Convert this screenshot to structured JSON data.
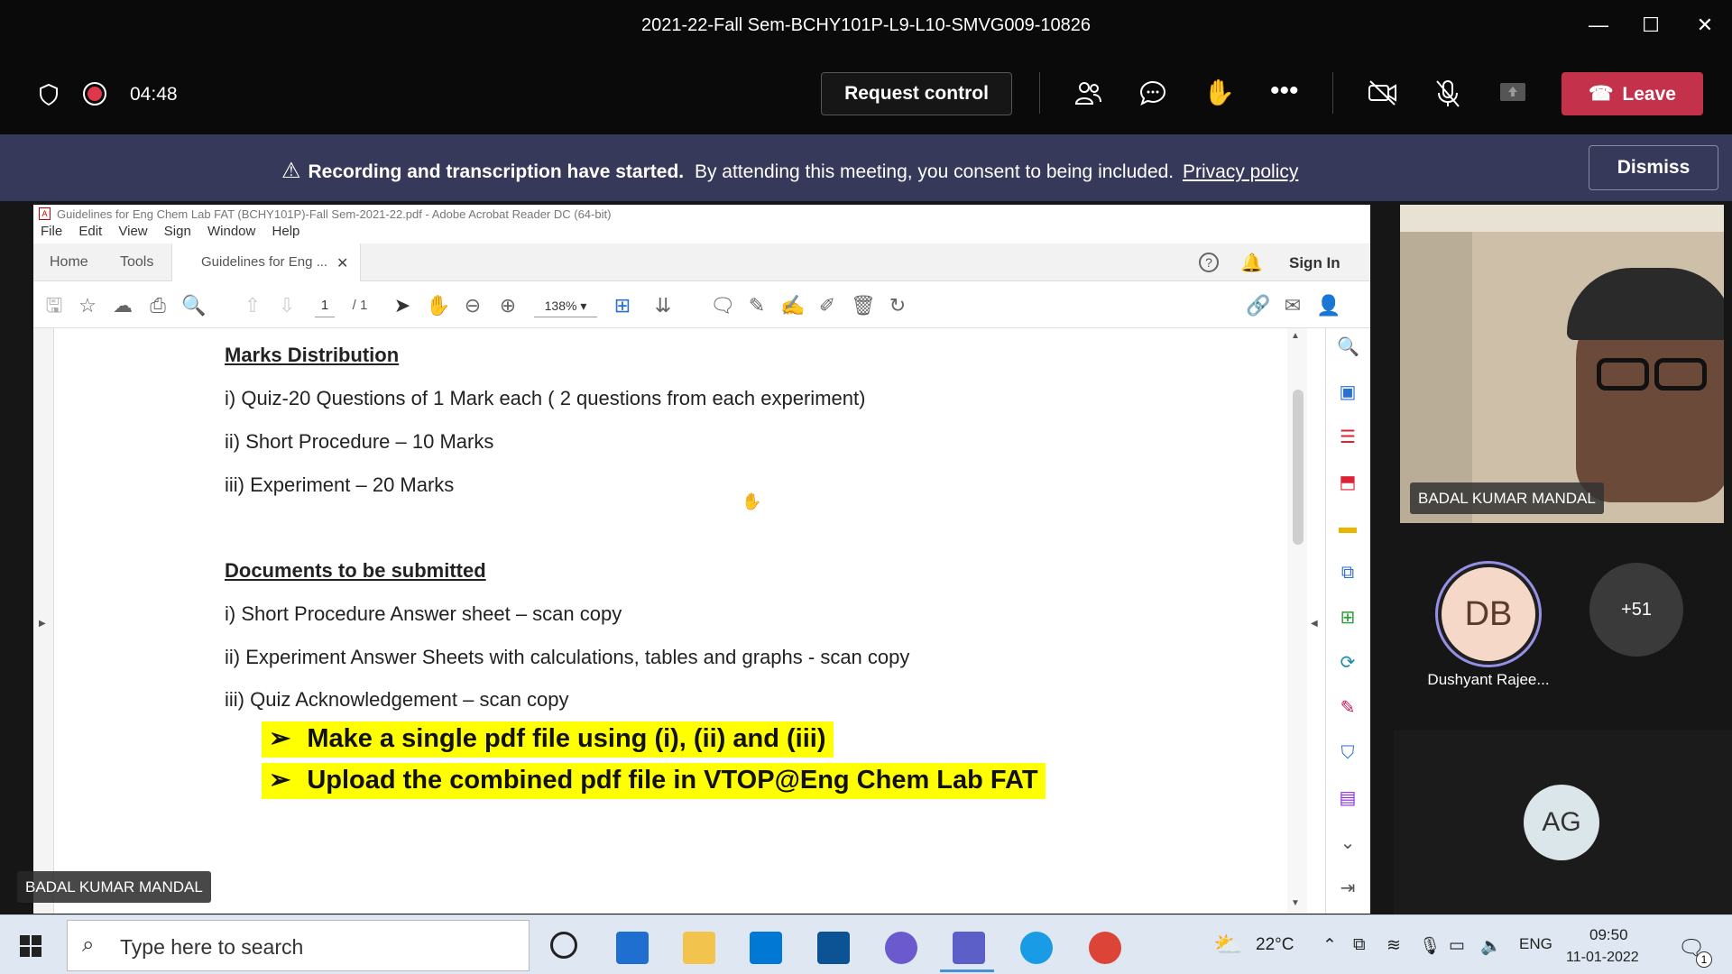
{
  "window": {
    "title": "2021-22-Fall Sem-BCHY101P-L9-L10-SMVG009-10826"
  },
  "meeting": {
    "timer": "04:48",
    "request_control": "Request control",
    "leave": "Leave"
  },
  "banner": {
    "bold": "Recording and transcription have started.",
    "text": "By attending this meeting, you consent to being included.",
    "link": "Privacy policy",
    "dismiss": "Dismiss"
  },
  "acrobat": {
    "title": "Guidelines for Eng Chem Lab FAT (BCHY101P)-Fall Sem-2021-22.pdf - Adobe Acrobat Reader DC (64-bit)",
    "menu": [
      "File",
      "Edit",
      "View",
      "Sign",
      "Window",
      "Help"
    ],
    "tabs": {
      "home": "Home",
      "tools": "Tools",
      "doc": "Guidelines for Eng ...",
      "signin": "Sign In"
    },
    "page_current": "1",
    "page_total": "/ 1",
    "zoom": "138%"
  },
  "document": {
    "h1": "Marks Distribution",
    "marks": [
      "i) Quiz-20 Questions of 1 Mark each ( 2 questions from each experiment)",
      "ii) Short Procedure – 10 Marks",
      "iii) Experiment – 20 Marks"
    ],
    "h2": "Documents to be submitted",
    "docs": [
      "i) Short Procedure Answer sheet – scan copy",
      "ii) Experiment Answer Sheets with calculations, tables and graphs  - scan copy",
      "iii) Quiz Acknowledgement – scan copy"
    ],
    "highlights": [
      "Make a single pdf file using (i), (ii) and (iii)",
      "Upload the combined pdf file in VTOP@Eng Chem Lab FAT"
    ]
  },
  "presenter_label": "BADAL KUMAR MANDAL",
  "participants": {
    "video_name": "BADAL KUMAR MANDAL",
    "db_initials": "DB",
    "db_name": "Dushyant Rajee...",
    "more": "+51",
    "ag_initials": "AG"
  },
  "taskbar": {
    "search": "Type here to search",
    "weather": "22°C",
    "lang": "ENG",
    "time": "09:50",
    "date": "11-01-2022",
    "notif": "1"
  },
  "colors": {
    "leave": "#c4314b",
    "banner": "#37395a",
    "highlight": "#ffff00"
  }
}
